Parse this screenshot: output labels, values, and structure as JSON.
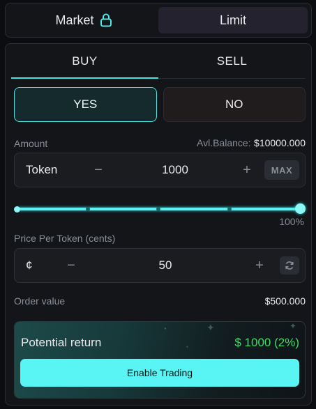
{
  "order_mode": {
    "tabs": [
      {
        "label": "Market",
        "icon": "lock-icon",
        "active": false
      },
      {
        "label": "Limit",
        "active": true
      }
    ]
  },
  "side_tabs": [
    {
      "label": "BUY",
      "active": true
    },
    {
      "label": "SELL",
      "active": false
    }
  ],
  "outcomes": [
    {
      "label": "YES",
      "selected": true
    },
    {
      "label": "NO",
      "selected": false
    }
  ],
  "amount": {
    "label": "Amount",
    "balance_label": "Avl.Balance:",
    "balance_value": "$10000.000",
    "unit": "Token",
    "value": "1000",
    "decrement": "−",
    "increment": "+",
    "max_label": "MAX"
  },
  "slider": {
    "percent": 100,
    "label": "100%",
    "steps": [
      0,
      25,
      50,
      75,
      100
    ]
  },
  "price": {
    "label": "Price Per Token (cents)",
    "currency_symbol": "¢",
    "value": "50",
    "decrement": "−",
    "increment": "+"
  },
  "order_value": {
    "label": "Order value",
    "value": "$500.000"
  },
  "potential_return": {
    "label": "Potential return",
    "value": "$ 1000 (2%)"
  },
  "enable_trading": {
    "label": "Enable Trading"
  },
  "colors": {
    "accent": "#59f4f4",
    "return_green": "#3ddc63",
    "background": "#0b0d10",
    "panel": "#131519"
  }
}
